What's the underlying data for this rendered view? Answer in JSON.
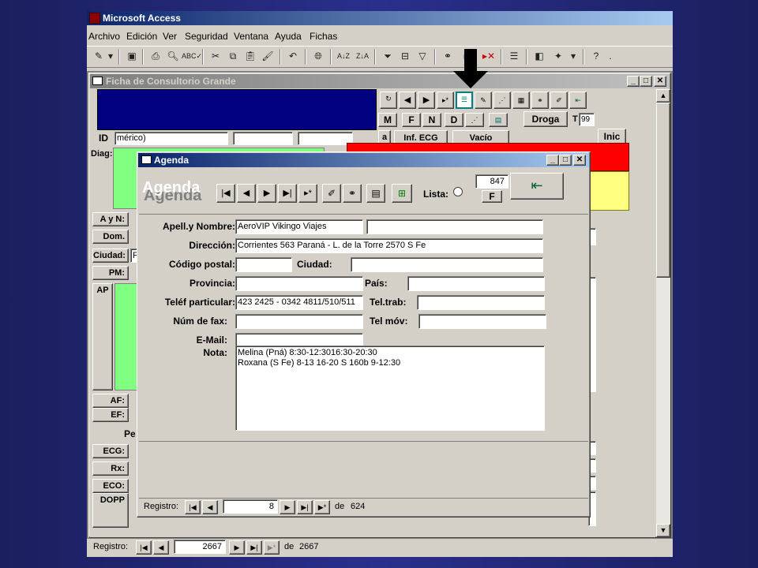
{
  "app": {
    "title": "Microsoft Access"
  },
  "menu": [
    "Archivo",
    "Edición",
    "Ver",
    "Seguridad",
    "Ventana",
    "Ayuda",
    "Fichas"
  ],
  "bg_window": {
    "title": "Ficha de Consultorio Grande",
    "id_label": "ID",
    "id_hint": "mérico)",
    "diag_label": "Diag:",
    "side_labels": [
      "A y N:",
      "Dom.",
      "Ciudad:",
      "PM:",
      "AP",
      "AF:",
      "EF:",
      "ECG:",
      "Rx:",
      "ECO:",
      "DOPP"
    ],
    "ciudad_value": "F",
    "pe_text": "Pe",
    "letter_buttons": [
      "M",
      "F",
      "N",
      "D"
    ],
    "extra_buttons": [
      "a",
      "Inf. ECG",
      "Vacío",
      "Droga",
      "Inic"
    ],
    "t_label": "T",
    "t_value": "99",
    "status": {
      "label": "Registro:",
      "current": "2667",
      "of": "de",
      "total": "2667"
    }
  },
  "agenda": {
    "window_title": "Agenda",
    "header": "Agenda",
    "lista_label": "Lista:",
    "count_value": "847",
    "f_button": "F",
    "labels": {
      "name": "Apell.y Nombre:",
      "address": "Dirección:",
      "postal": "Código postal:",
      "city": "Ciudad:",
      "province": "Provincia:",
      "country": "País:",
      "phone": "Teléf particular:",
      "work_phone": "Tel.trab:",
      "fax": "Núm de fax:",
      "mobile": "Tel móv:",
      "email": "E-Mail:",
      "note": "Nota:"
    },
    "values": {
      "name": "AeroVIP Vikingo Viajes",
      "name2": "",
      "address": "Corrientes 563 Paraná - L. de la Torre 2570 S Fe",
      "postal": "",
      "city": "",
      "province": "",
      "country": "",
      "phone": "423 2425 - 0342 4811/510/511",
      "work_phone": "",
      "fax": "",
      "mobile": "",
      "email": "",
      "note_line1": "Melina (Pná) 8:30-12:3016:30-20:30",
      "note_line2": "Roxana (S Fe) 8-13 16-20 S 160b 9-12:30"
    },
    "status": {
      "label": "Registro:",
      "current": "8",
      "of": "de",
      "total": "624"
    }
  },
  "colors": {
    "title_active": "#0a246a",
    "record_green": "#80ff80",
    "record_navy": "#000080",
    "alert_red": "#ff0000",
    "alert_yellow": "#ffff80"
  }
}
